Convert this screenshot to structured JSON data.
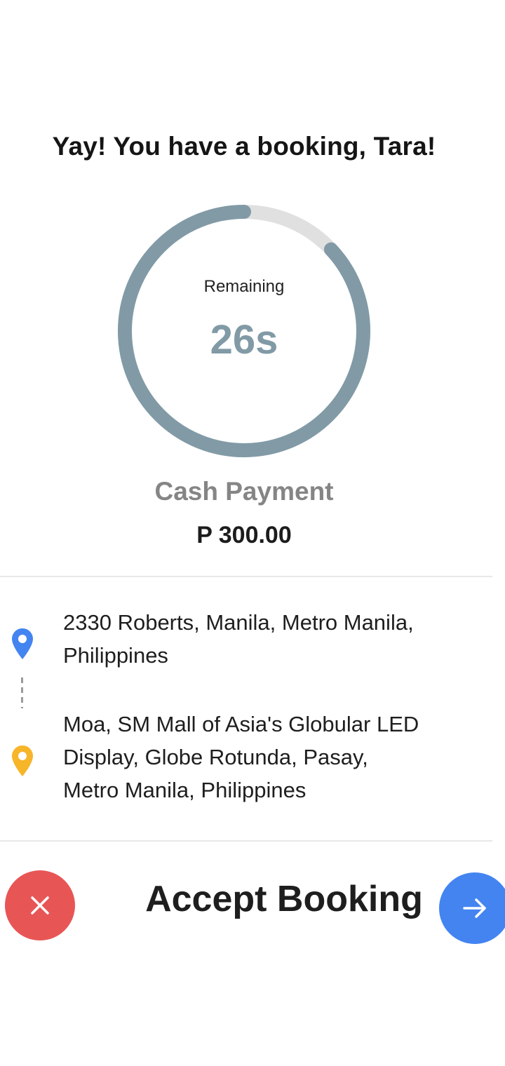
{
  "header": {
    "greeting": "Yay! You have a booking, Tara!"
  },
  "timer": {
    "label": "Remaining",
    "value": "26s",
    "remaining_fraction": 0.87,
    "track_color": "#e0e0e0",
    "progress_color": "#819aa6"
  },
  "payment": {
    "type": "Cash Payment",
    "amount": "P 300.00"
  },
  "route": {
    "pickup": {
      "address_line1": "2330 Roberts, Manila, Metro Manila,",
      "address_line2": "Philippines",
      "icon": "map-pin-icon",
      "color": "#4384f1"
    },
    "dropoff": {
      "address_line1": "Moa, SM Mall of Asia's Globular LED",
      "address_line2": "Display, Globe Rotunda, Pasay,",
      "address_line3": "Metro Manila, Philippines",
      "icon": "map-pin-icon",
      "color": "#f7b52a"
    }
  },
  "actions": {
    "reject_icon": "close-icon",
    "reject_color": "#e85555",
    "accept_label": "Accept Booking",
    "accept_icon": "arrow-right-icon",
    "accept_color": "#4384f1"
  }
}
